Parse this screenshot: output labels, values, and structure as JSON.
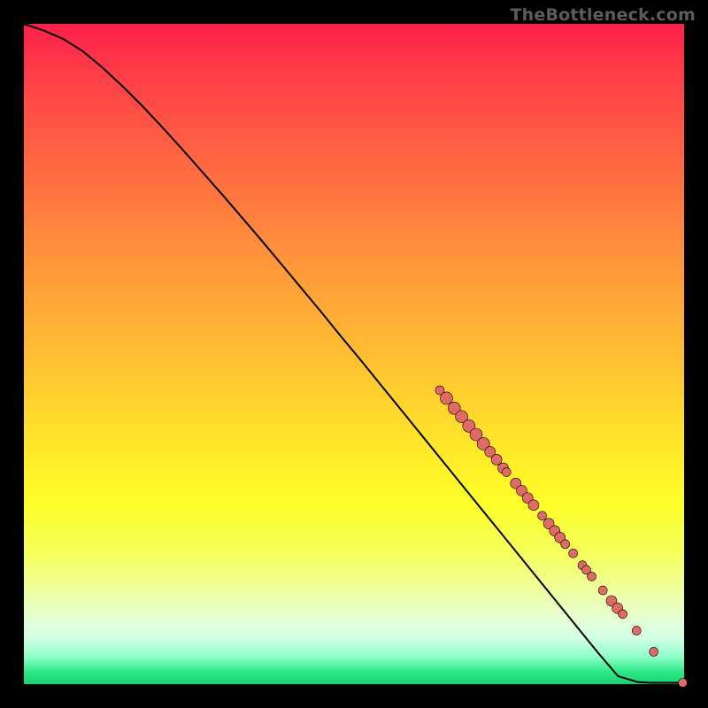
{
  "watermark": "TheBottleneck.com",
  "colors": {
    "curve": "#000000",
    "marker": "#e06a66",
    "markerStroke": "#000000"
  },
  "chart_data": {
    "type": "line",
    "title": "",
    "xlabel": "",
    "ylabel": "",
    "xlim": [
      0,
      100
    ],
    "ylim": [
      0,
      100
    ],
    "series": [
      {
        "name": "curve",
        "x": [
          0,
          3,
          6,
          9,
          12,
          15,
          18,
          21,
          24,
          27,
          30,
          33,
          36,
          39,
          42,
          45,
          48,
          51,
          54,
          57,
          60,
          63,
          66,
          69,
          72,
          75,
          78,
          81,
          84,
          87,
          90,
          93,
          95,
          100
        ],
        "y": [
          100,
          99.0,
          97.7,
          95.8,
          93.3,
          90.5,
          87.5,
          84.3,
          81.0,
          77.6,
          74.2,
          70.7,
          67.2,
          63.6,
          60.0,
          56.4,
          52.7,
          49.1,
          45.4,
          41.7,
          38.0,
          34.3,
          30.6,
          26.9,
          23.2,
          19.5,
          15.8,
          12.1,
          8.4,
          4.7,
          1.2,
          0.3,
          0.2,
          0.2
        ]
      }
    ],
    "markers": {
      "name": "highlighted-points",
      "color": "#e06a66",
      "points": [
        {
          "x": 63.0,
          "y": 44.5,
          "r": 5
        },
        {
          "x": 64.0,
          "y": 43.3,
          "r": 7
        },
        {
          "x": 65.2,
          "y": 41.8,
          "r": 7
        },
        {
          "x": 66.3,
          "y": 40.5,
          "r": 7
        },
        {
          "x": 67.4,
          "y": 39.1,
          "r": 7
        },
        {
          "x": 68.5,
          "y": 37.8,
          "r": 7
        },
        {
          "x": 69.6,
          "y": 36.4,
          "r": 7
        },
        {
          "x": 70.6,
          "y": 35.2,
          "r": 6
        },
        {
          "x": 71.6,
          "y": 34.0,
          "r": 6
        },
        {
          "x": 72.6,
          "y": 32.7,
          "r": 6
        },
        {
          "x": 73.1,
          "y": 32.1,
          "r": 5
        },
        {
          "x": 74.5,
          "y": 30.4,
          "r": 6
        },
        {
          "x": 75.4,
          "y": 29.3,
          "r": 6
        },
        {
          "x": 76.3,
          "y": 28.2,
          "r": 6
        },
        {
          "x": 77.2,
          "y": 27.1,
          "r": 6
        },
        {
          "x": 78.5,
          "y": 25.5,
          "r": 5
        },
        {
          "x": 79.5,
          "y": 24.3,
          "r": 6
        },
        {
          "x": 80.4,
          "y": 23.2,
          "r": 6
        },
        {
          "x": 81.2,
          "y": 22.2,
          "r": 6
        },
        {
          "x": 82.0,
          "y": 21.2,
          "r": 5
        },
        {
          "x": 83.2,
          "y": 19.8,
          "r": 5
        },
        {
          "x": 84.6,
          "y": 18.0,
          "r": 5
        },
        {
          "x": 85.2,
          "y": 17.3,
          "r": 5
        },
        {
          "x": 86.0,
          "y": 16.3,
          "r": 5
        },
        {
          "x": 87.7,
          "y": 14.2,
          "r": 5
        },
        {
          "x": 89.0,
          "y": 12.6,
          "r": 6
        },
        {
          "x": 89.9,
          "y": 11.5,
          "r": 6
        },
        {
          "x": 90.7,
          "y": 10.6,
          "r": 5
        },
        {
          "x": 92.8,
          "y": 8.1,
          "r": 5
        },
        {
          "x": 95.4,
          "y": 4.9,
          "r": 5
        },
        {
          "x": 99.8,
          "y": 0.2,
          "r": 5
        }
      ]
    }
  }
}
